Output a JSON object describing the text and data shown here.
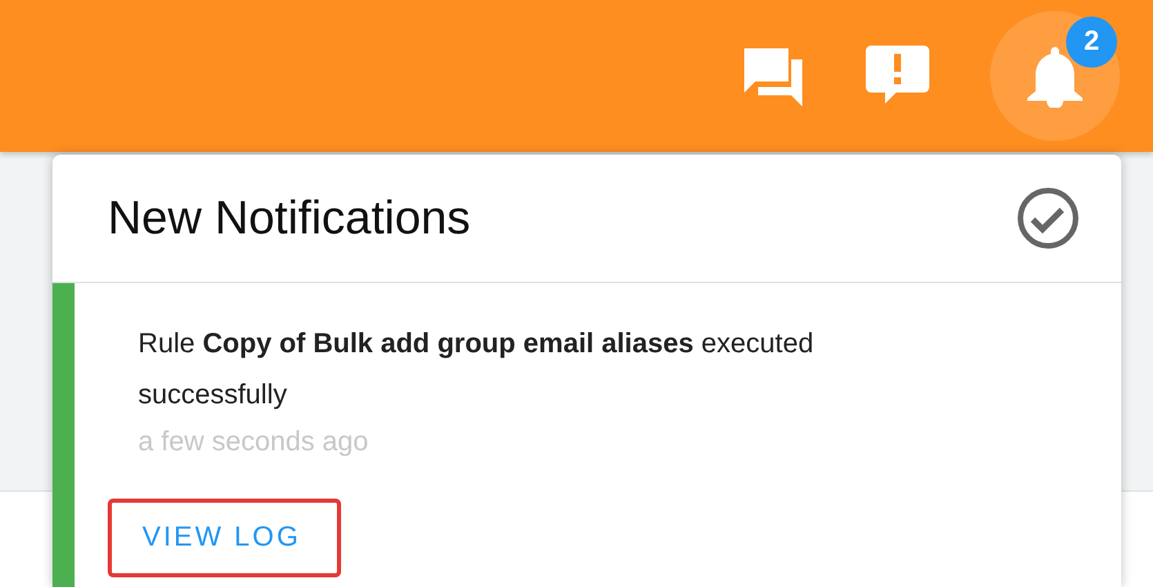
{
  "header": {
    "notification_count": "2"
  },
  "notifications_panel": {
    "title": "New Notifications",
    "items": [
      {
        "message": "Rule **Copy of Bulk add group email aliases** executed successfully",
        "time": "a few seconds ago",
        "color": "#4caf50",
        "action": "VIEW LOG"
      }
    ]
  }
}
